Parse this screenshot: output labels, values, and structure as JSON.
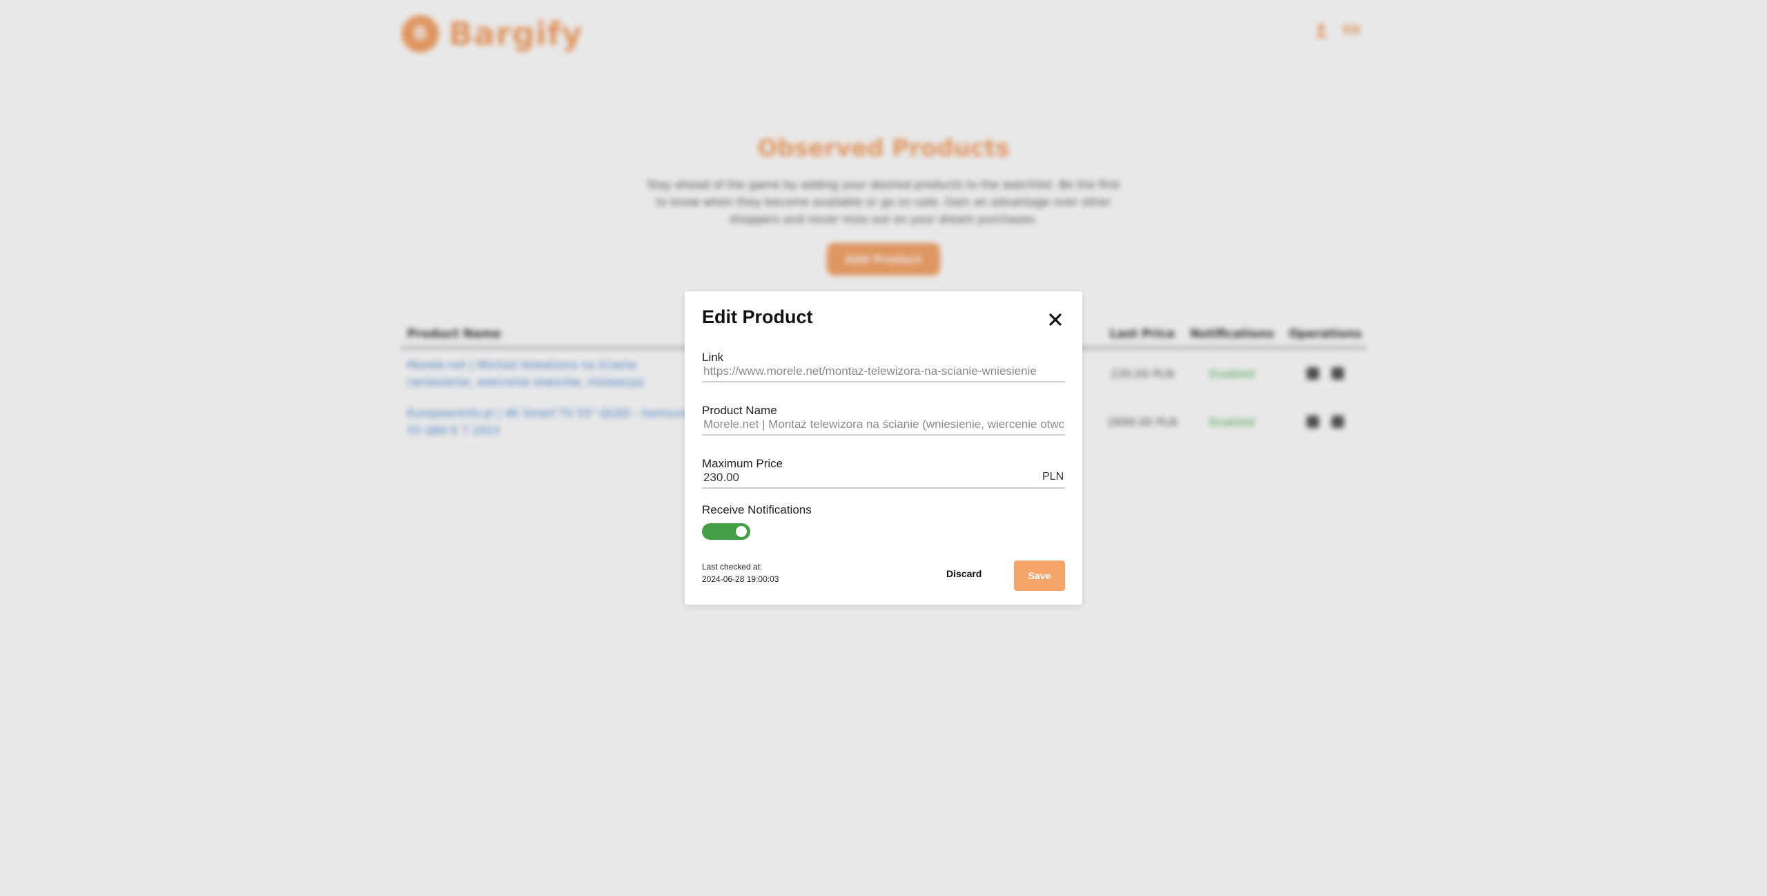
{
  "header": {
    "logo_text": "Bargify",
    "logo_mark": "B",
    "lang": "EN",
    "user_icon": "user-icon"
  },
  "hero": {
    "title": "Observed Products",
    "description": "Stay ahead of the game by adding your desired products to the watchlist. Be the first to know when they become available or go on sale. Gain an advantage over other shoppers and never miss out on your dream purchases.",
    "add_button": "Add Product"
  },
  "table": {
    "headers": [
      "Product Name",
      "Last Price",
      "Notifications",
      "Operations"
    ],
    "rows": [
      {
        "name": "Morele.net | Montaż telewizora na ścianie (wniesienie, wiercenie otworów, instalacja)",
        "price": "230.00 PLN",
        "notifications": "Enabled"
      },
      {
        "name": "Europeaninfo.pl | 4K Smart TV 55\" QLED - Samsung 55 Q60 E 7 2023",
        "price": "2699.00 PLN",
        "notifications": "Enabled"
      }
    ]
  },
  "modal": {
    "title": "Edit Product",
    "link_label": "Link",
    "link_placeholder": "https://www.morele.net/montaz-telewizora-na-scianie-wniesienie",
    "name_label": "Product Name",
    "name_placeholder": "Morele.net | Montaż telewizora na ścianie (wniesienie, wiercenie otworów)",
    "price_label": "Maximum Price",
    "price_value": "230.00",
    "price_suffix": "PLN",
    "notifications_label": "Receive Notifications",
    "notifications_on": true,
    "last_checked_label": "Last checked at:",
    "last_checked_value": "2024-06-28 19:00:03",
    "discard_label": "Discard",
    "save_label": "Save"
  },
  "colors": {
    "accent": "#f6a56a",
    "toggle_on": "#43a047",
    "link": "#4a89d8",
    "enabled": "#4caf50"
  }
}
